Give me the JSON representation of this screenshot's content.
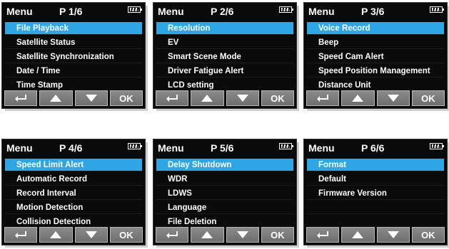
{
  "menu_label": "Menu",
  "buttons": {
    "back_icon": "return-icon",
    "up_icon": "triangle-up-icon",
    "down_icon": "triangle-down-icon",
    "ok_label": "OK"
  },
  "colors": {
    "selected": "#2ea6e6",
    "background": "#0a0a0a",
    "text": "#ffffff"
  },
  "screens": [
    {
      "page": "P 1/6",
      "items": [
        "File Playback",
        "Satellite Status",
        "Satellite Synchronization",
        "Date / Time",
        "Time Stamp"
      ],
      "selected_index": 0
    },
    {
      "page": "P 2/6",
      "items": [
        "Resolution",
        "EV",
        "Smart Scene Mode",
        "Driver Fatigue Alert",
        "LCD setting"
      ],
      "selected_index": 0
    },
    {
      "page": "P 3/6",
      "items": [
        "Voice Record",
        "Beep",
        "Speed Cam Alert",
        "Speed Position Management",
        "Distance Unit"
      ],
      "selected_index": 0
    },
    {
      "page": "P 4/6",
      "items": [
        "Speed Limit Alert",
        "Automatic Record",
        "Record Interval",
        "Motion Detection",
        "Collision Detection"
      ],
      "selected_index": 0
    },
    {
      "page": "P 5/6",
      "items": [
        "Delay Shutdown",
        "WDR",
        "LDWS",
        "Language",
        "File Deletion"
      ],
      "selected_index": 0
    },
    {
      "page": "P 6/6",
      "items": [
        "Format",
        "Default",
        "Firmware Version",
        "",
        ""
      ],
      "selected_index": 0
    }
  ]
}
